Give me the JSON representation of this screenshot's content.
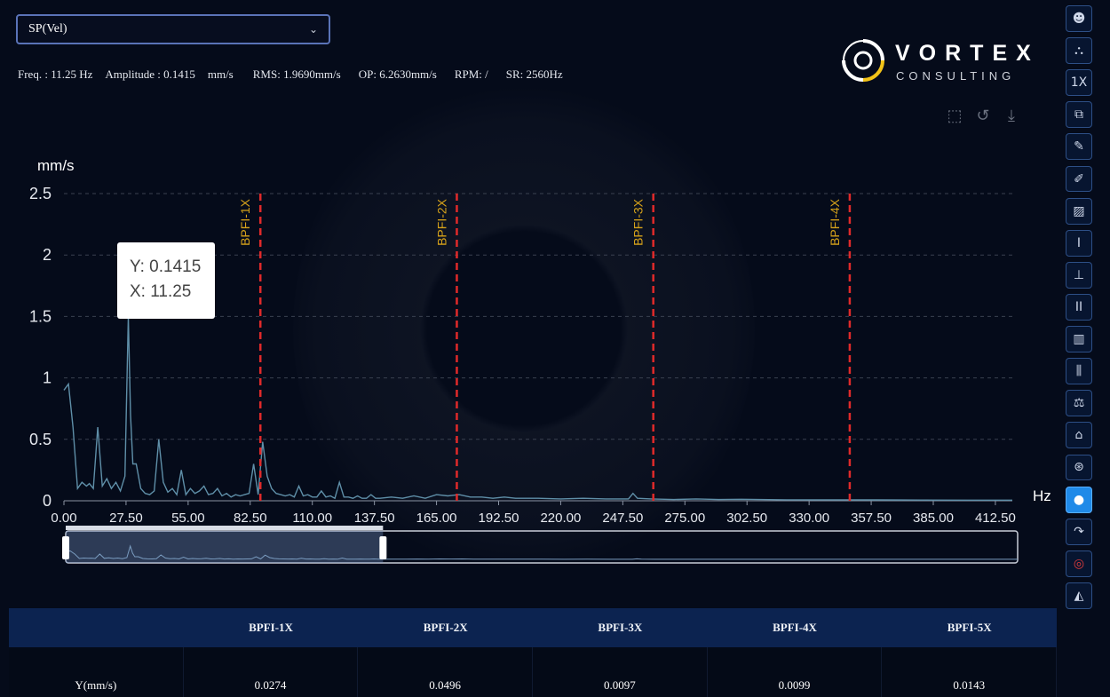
{
  "selector": {
    "value": "SP(Vel)"
  },
  "info": {
    "freq": "Freq. : 11.25 Hz",
    "amplitude": "Amplitude : 0.1415",
    "amp_unit": "mm/s",
    "rms": "RMS: 1.9690mm/s",
    "op": "OP: 6.2630mm/s",
    "rpm": "RPM: /",
    "sr": "SR: 2560Hz"
  },
  "logo": {
    "line1": "VORTEX",
    "line2": "CONSULTING"
  },
  "tooltip": {
    "y": "Y: 0.1415",
    "x": "X: 11.25"
  },
  "chart_data": {
    "type": "line",
    "ylabel": "mm/s",
    "xlabel": "Hz",
    "ylim": [
      0,
      2.5
    ],
    "xlim": [
      0,
      420
    ],
    "y_ticks": [
      "0",
      "0.5",
      "1",
      "1.5",
      "2",
      "2.5"
    ],
    "x_ticks": [
      "0.00",
      "27.50",
      "55.00",
      "82.50",
      "110.00",
      "137.50",
      "165.00",
      "192.50",
      "220.00",
      "247.50",
      "275.00",
      "302.50",
      "330.00",
      "357.50",
      "385.00",
      "412.50"
    ],
    "grid": "horizontal dashed",
    "series": [
      {
        "x": [
          0,
          2,
          4,
          6,
          8,
          10,
          11.25,
          13,
          15,
          17,
          19,
          21,
          23,
          25,
          27,
          28.5,
          29.5,
          30.5,
          32,
          34,
          36,
          38,
          40,
          42,
          44,
          46,
          48,
          50,
          52,
          54,
          56,
          58,
          60,
          62,
          64,
          66,
          68,
          70,
          72,
          74,
          76,
          78,
          80,
          82,
          84,
          86,
          88,
          90,
          92,
          94,
          96,
          98,
          100,
          102,
          104,
          106,
          108,
          110,
          112,
          114,
          116,
          118,
          120,
          122,
          124,
          126,
          128,
          130,
          132,
          134,
          136,
          138,
          140,
          145,
          150,
          155,
          160,
          165,
          170,
          175,
          180,
          185,
          190,
          195,
          200,
          210,
          220,
          230,
          240,
          250,
          252,
          254,
          260,
          270,
          280,
          290,
          300,
          320,
          340,
          360,
          380,
          400,
          420
        ],
        "y": [
          0.9,
          0.95,
          0.6,
          0.1,
          0.15,
          0.12,
          0.14,
          0.1,
          0.6,
          0.12,
          0.18,
          0.1,
          0.15,
          0.08,
          0.2,
          1.5,
          0.7,
          0.3,
          0.3,
          0.1,
          0.06,
          0.05,
          0.08,
          0.5,
          0.15,
          0.07,
          0.1,
          0.05,
          0.25,
          0.05,
          0.1,
          0.06,
          0.08,
          0.12,
          0.05,
          0.06,
          0.1,
          0.04,
          0.06,
          0.03,
          0.05,
          0.04,
          0.05,
          0.06,
          0.3,
          0.05,
          0.48,
          0.2,
          0.1,
          0.06,
          0.05,
          0.04,
          0.05,
          0.03,
          0.12,
          0.04,
          0.05,
          0.03,
          0.03,
          0.08,
          0.03,
          0.04,
          0.02,
          0.15,
          0.03,
          0.03,
          0.02,
          0.04,
          0.02,
          0.02,
          0.05,
          0.02,
          0.02,
          0.03,
          0.02,
          0.04,
          0.02,
          0.05,
          0.04,
          0.05,
          0.03,
          0.03,
          0.02,
          0.03,
          0.02,
          0.02,
          0.015,
          0.02,
          0.015,
          0.015,
          0.06,
          0.02,
          0.015,
          0.01,
          0.015,
          0.01,
          0.012,
          0.008,
          0.008,
          0.007,
          0.006,
          0.005,
          0.005
        ]
      }
    ],
    "markers": [
      {
        "label": "BPFI-1X",
        "x": 87
      },
      {
        "label": "BPFI-2X",
        "x": 174
      },
      {
        "label": "BPFI-3X",
        "x": 261
      },
      {
        "label": "BPFI-4X",
        "x": 348
      }
    ],
    "zoom_window": [
      0,
      140
    ]
  },
  "sidebar": {
    "icons": [
      "robot-icon",
      "hierarchy-icon",
      "1x-icon",
      "compare-icon",
      "edit-icon",
      "edit-alt-icon",
      "waveform-icon",
      "cursor-single-icon",
      "cursor-base-icon",
      "cursor-double-icon",
      "harmonic-icon",
      "sideband-icon",
      "balance-icon",
      "house-icon",
      "gear-target-icon",
      "circle-active-icon",
      "curve-arrow-icon",
      "target-icon",
      "envelope-icon"
    ],
    "labels": [
      "☻",
      "⛬",
      "1X",
      "⧉",
      "✎",
      "✐",
      "▨",
      "I",
      "⊥",
      "II",
      "▥",
      "⫼",
      "⚖",
      "⌂",
      "⊛",
      "●",
      "↷",
      "◎",
      "◭"
    ]
  },
  "table": {
    "headers": [
      "",
      "BPFI-1X",
      "BPFI-2X",
      "BPFI-3X",
      "BPFI-4X",
      "BPFI-5X"
    ],
    "row_label": "Y(mm/s)",
    "values": [
      "0.0274",
      "0.0496",
      "0.0097",
      "0.0099",
      "0.0143"
    ]
  }
}
